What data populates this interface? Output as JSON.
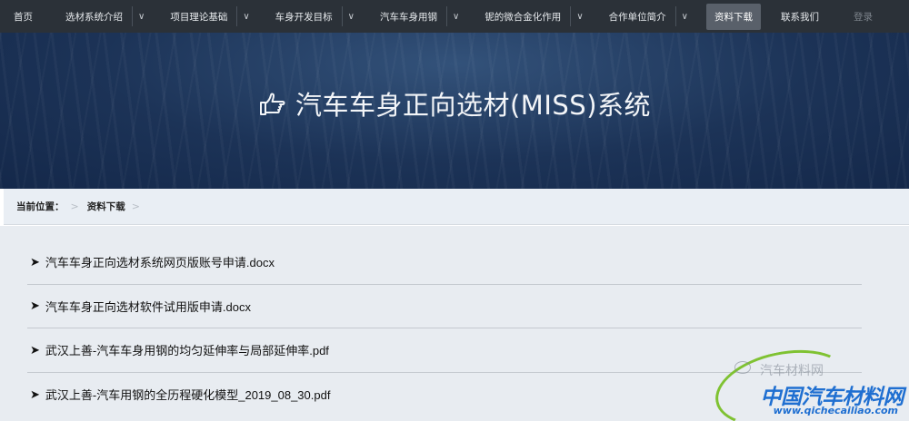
{
  "nav": {
    "items": [
      {
        "label": "首页",
        "has_dropdown": false
      },
      {
        "label": "选材系统介绍",
        "has_dropdown": true
      },
      {
        "label": "项目理论基础",
        "has_dropdown": true
      },
      {
        "label": "车身开发目标",
        "has_dropdown": true
      },
      {
        "label": "汽车车身用钢",
        "has_dropdown": true
      },
      {
        "label": "铌的微合金化作用",
        "has_dropdown": true
      },
      {
        "label": "合作单位简介",
        "has_dropdown": true
      },
      {
        "label": "资料下载",
        "has_dropdown": false,
        "active": true
      },
      {
        "label": "联系我们",
        "has_dropdown": false
      }
    ],
    "dropdown_glyph": "∨",
    "login": "登录"
  },
  "hero": {
    "title": "汽车车身正向选材(MISS)系统",
    "icon": "pointing-hand-icon"
  },
  "breadcrumb": {
    "label": "当前位置：",
    "separator": ">",
    "items": [
      "资料下载"
    ]
  },
  "files": {
    "bullet": "➤",
    "items": [
      "汽车车身正向选材系统网页版账号申请.docx",
      "汽车车身正向选材软件试用版申请.docx",
      "武汉上善-汽车车身用钢的均匀延伸率与局部延伸率.pdf",
      "武汉上善-汽车用钢的全历程硬化模型_2019_08_30.pdf"
    ]
  },
  "watermark": {
    "small_text": "汽车材料网",
    "big_text": "中国汽车材料网",
    "url": "www.qichecailiao.com"
  },
  "colors": {
    "nav_bg": "#2b3138",
    "nav_active_bg": "#59606a",
    "hero_bg": "#1c3357",
    "content_bg": "#e8ecf1",
    "watermark_blue": "#1f6fd1",
    "watermark_green": "#7fc232"
  }
}
